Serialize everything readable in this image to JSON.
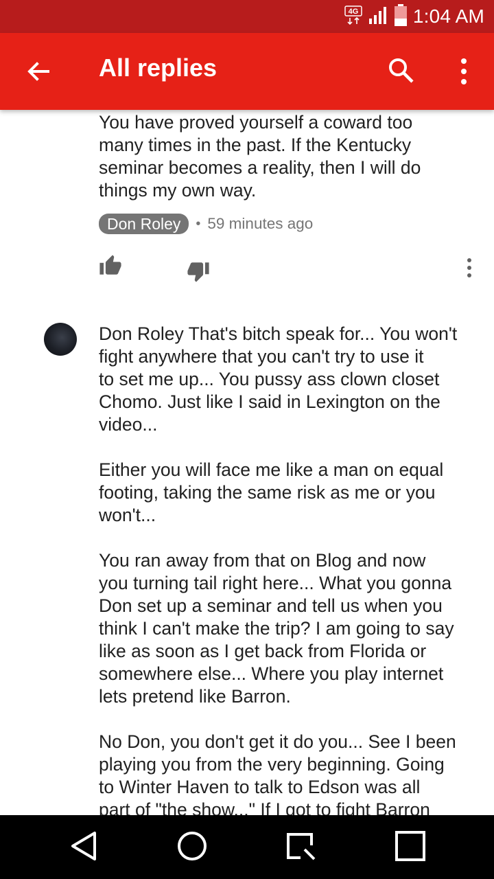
{
  "status_bar": {
    "network": "4G",
    "time": "1:04 AM",
    "icons": [
      "network-4g-icon",
      "signal-icon",
      "battery-icon"
    ]
  },
  "app_bar": {
    "title": "All replies",
    "icons": [
      "back-arrow-icon",
      "search-icon",
      "more-vert-icon"
    ],
    "colors": {
      "app_bar": "#e62117",
      "status_bar": "#b71c1c"
    }
  },
  "comment1": {
    "text": "You have proved yourself a coward too\nmany times in the past. If the Kentucky\nseminar becomes a reality, then I will do\nthings my own way.",
    "author": "Don Roley",
    "separator": "•",
    "time_ago": "59 minutes ago",
    "icons": [
      "thumb-up-icon",
      "thumb-down-icon",
      "more-vert-icon"
    ]
  },
  "comment2": {
    "avatar": "avatar",
    "text": "Don Roley That's bitch speak for... You won't\nfight anywhere that you can't try to use it\nto set me up... You pussy ass clown closet\nChomo. Just like I said in Lexington on the\nvideo...\n\nEither you will face me like a man on equal\nfooting, taking the same risk as me or you\nwon't...\n\nYou ran away from that on Blog and now\nyou turning tail right here... What you gonna\nDon set up a seminar and tell us when you\nthink I can't make the trip? I am going to say\nlike as soon as I get back from Florida or\nsomewhere else... Where you play internet\nlets pretend like Barron.\n\nNo Don, you don't get it do you... See I been\nplaying you from the very beginning. Going\nto Winter Haven to talk to Edson was all\npart of \"the show...\" If I got to fight Barron"
  },
  "nav_bar": {
    "icons": [
      "nav-back-icon",
      "nav-home-icon",
      "nav-recents-icon",
      "nav-overview-icon"
    ]
  }
}
